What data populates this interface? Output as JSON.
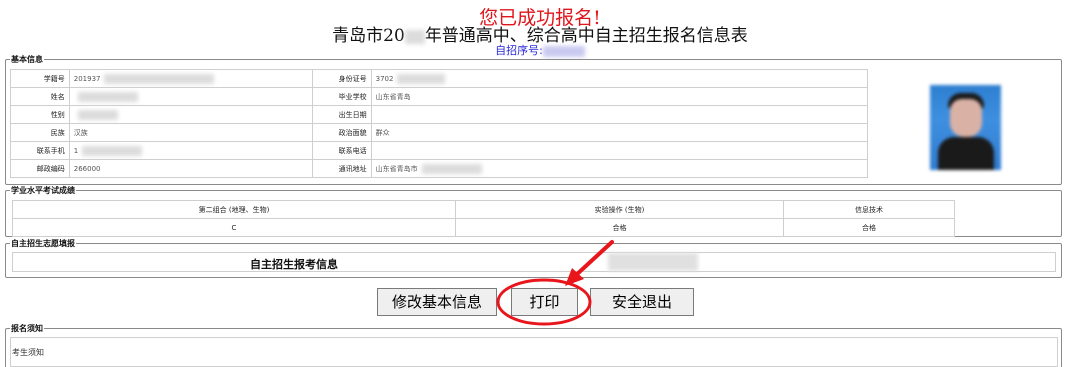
{
  "header": {
    "success": "您已成功报名!",
    "title_prefix": "青岛市20",
    "title_suffix": "年普通高中、综合高中自主招生报名信息表",
    "seq_label": "自招序号:"
  },
  "basic": {
    "legend": "基本信息",
    "rows": [
      {
        "l1": "学籍号",
        "v1": "201937",
        "l2": "身份证号",
        "v2": "3702"
      },
      {
        "l1": "姓名",
        "v1": "",
        "l2": "毕业学校",
        "v2": "山东省青岛"
      },
      {
        "l1": "性别",
        "v1": "",
        "l2": "出生日期",
        "v2": ""
      },
      {
        "l1": "民族",
        "v1": "汉族",
        "l2": "政治面貌",
        "v2": "群众"
      },
      {
        "l1": "联系手机",
        "v1": "1",
        "l2": "联系电话",
        "v2": ""
      },
      {
        "l1": "邮政编码",
        "v1": "266000",
        "l2": "通讯地址",
        "v2": "山东省青岛市"
      }
    ]
  },
  "scores": {
    "legend": "学业水平考试成绩",
    "headers": [
      "第二组合 (地理、生物)",
      "实验操作 (生物)",
      "信息技术"
    ],
    "values": [
      "C",
      "合格",
      "合格"
    ]
  },
  "volunteer": {
    "legend": "自主招生志愿填报",
    "label": "自主招生报考信息"
  },
  "buttons": {
    "edit": "修改基本信息",
    "print": "打印",
    "logout": "安全退出"
  },
  "notice": {
    "legend": "报名须知",
    "text": "考生须知"
  },
  "colors": {
    "success_red": "#e0151b",
    "seq_blue": "#2a2ad8",
    "annotation_red": "#e8151b"
  }
}
